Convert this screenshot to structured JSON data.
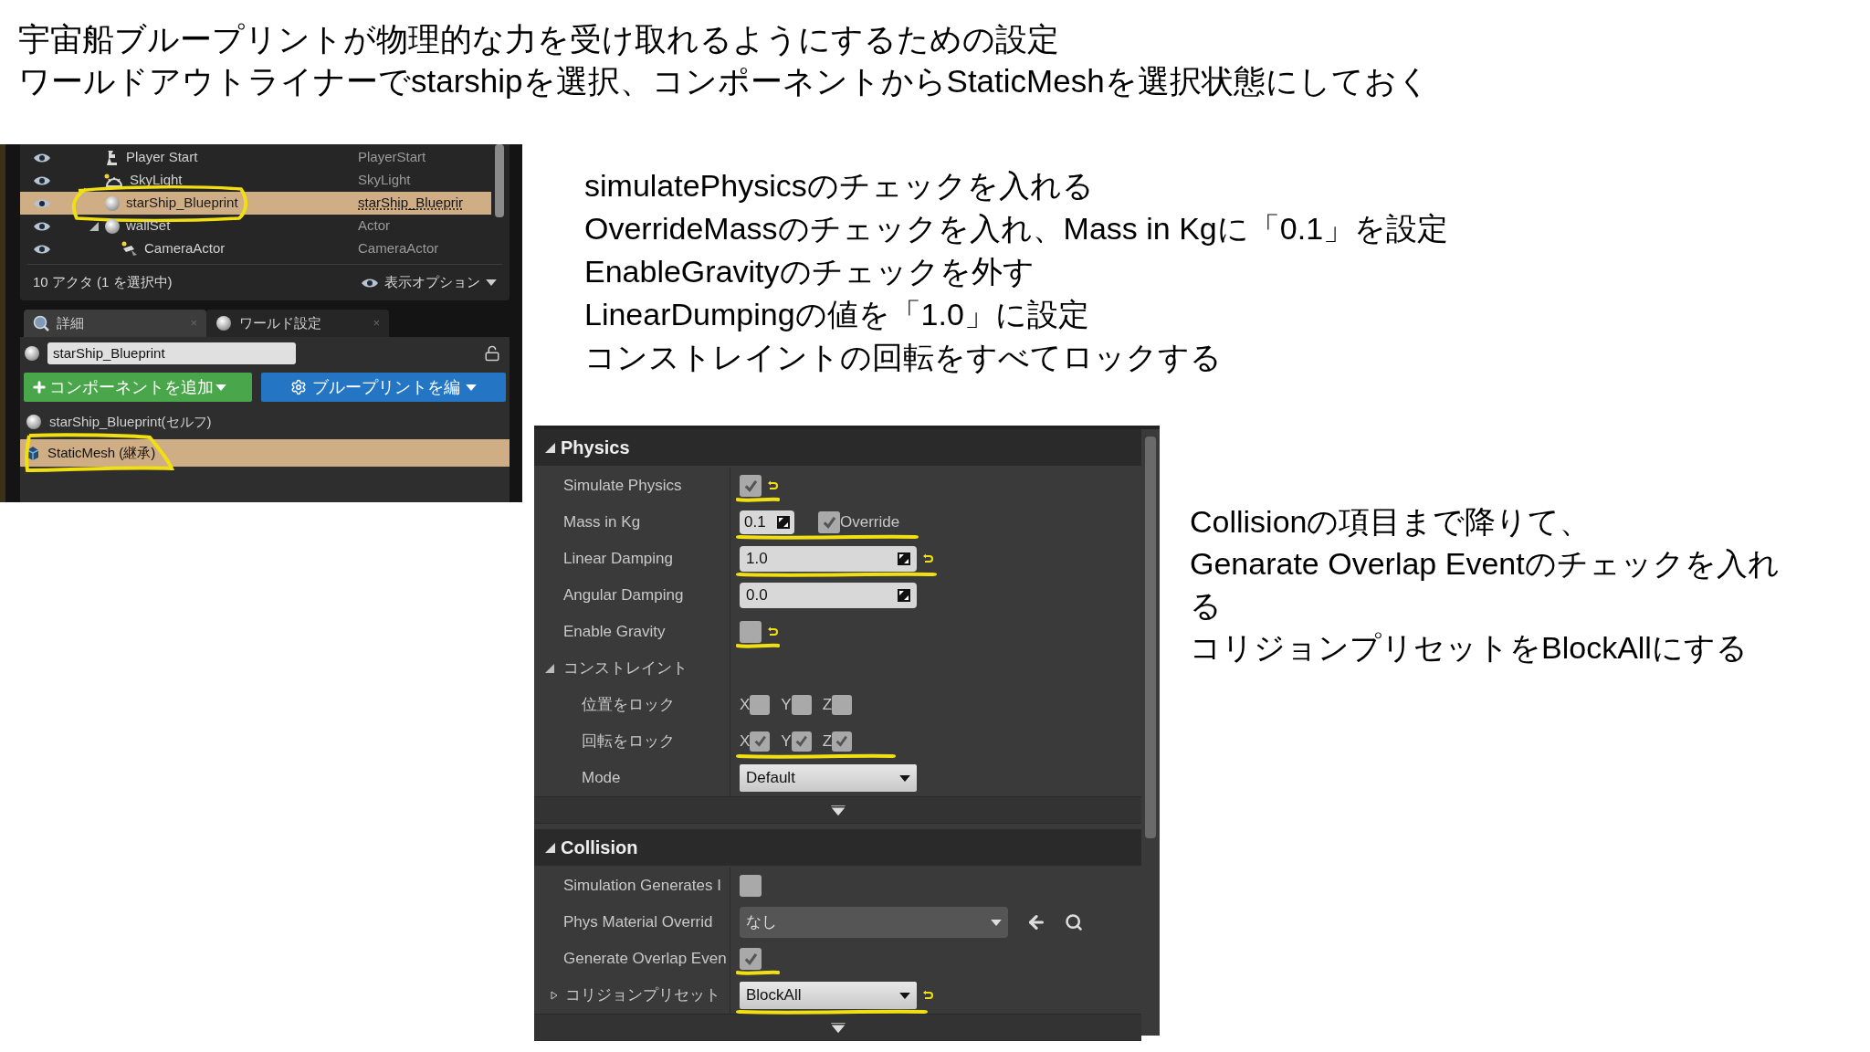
{
  "heading": [
    "宇宙船ブループリントが物理的な力を受け取れるようにするための設定",
    "ワールドアウトライナーでstarshipを選択、コンポーネントからStaticMeshを選択状態にしておく"
  ],
  "outliner": {
    "rows": [
      {
        "kind": "player",
        "name": "Player Start",
        "type": "PlayerStart",
        "selected": false,
        "marked": false
      },
      {
        "kind": "light",
        "name": "SkyLight",
        "type": "SkyLight",
        "selected": false,
        "marked": false
      },
      {
        "kind": "sphere",
        "name": "starShip_Blueprint",
        "type": "starShip_Blueprir",
        "selected": true,
        "marked": true
      },
      {
        "kind": "sphere",
        "name": "wallSet",
        "type": "Actor",
        "selected": false,
        "marked": false,
        "expanded": true,
        "children": [
          {
            "kind": "camera",
            "name": "CameraActor",
            "type": "CameraActor",
            "selected": false,
            "marked": false
          }
        ]
      }
    ],
    "footer": "10 アクタ (1 を選択中)",
    "view_options": "表示オプション"
  },
  "details": {
    "tabs": [
      {
        "label": "詳細",
        "selected": true,
        "close": "×"
      },
      {
        "label": "ワールド設定",
        "selected": false,
        "close": "×"
      }
    ],
    "name_field": "starShip_Blueprint",
    "add_button": "コンポーネントを追加",
    "blueprint_button": "ブループリントを編",
    "components": [
      {
        "name": "starShip_Blueprint(セルフ)",
        "selected": false,
        "marked": false
      },
      {
        "name": "StaticMesh (継承)",
        "selected": true,
        "marked": true
      }
    ]
  },
  "instructions": [
    "simulatePhysicsのチェックを入れる",
    "OverrideMassのチェックを入れ、Mass in Kgに「0.1」を設定",
    "EnableGravityのチェックを外す",
    "LinearDumpingの値を「1.0」に設定",
    "コンストレイントの回転をすべてロックする"
  ],
  "properties": {
    "sections": [
      {
        "title": "Physics",
        "expanded": true,
        "rows": [
          {
            "kind": "checkbox",
            "label": "Simulate Physics",
            "checked": true,
            "reset": true,
            "marked": true
          },
          {
            "kind": "mass",
            "label": "Mass in Kg",
            "value": "0.1",
            "override": {
              "label": "Override",
              "checked": true
            },
            "marked": true
          },
          {
            "kind": "number",
            "label": "Linear Damping",
            "value": "1.0",
            "reset": true,
            "marked": true
          },
          {
            "kind": "number",
            "label": "Angular Damping",
            "value": "0.0",
            "reset": false,
            "marked": false
          },
          {
            "kind": "checkbox",
            "label": "Enable Gravity",
            "checked": false,
            "reset": true,
            "marked": true
          },
          {
            "kind": "group",
            "label": "コンストレイント",
            "expanded": true
          },
          {
            "kind": "axes",
            "label": "位置をロック",
            "axes": [
              {
                "label": "X",
                "checked": false
              },
              {
                "label": "Y",
                "checked": false
              },
              {
                "label": "Z",
                "checked": false
              }
            ],
            "marked": false
          },
          {
            "kind": "axes",
            "label": "回転をロック",
            "axes": [
              {
                "label": "X",
                "checked": true
              },
              {
                "label": "Y",
                "checked": true
              },
              {
                "label": "Z",
                "checked": true
              }
            ],
            "marked": true
          },
          {
            "kind": "dropdown",
            "label": "Mode",
            "value": "Default",
            "reset": false,
            "marked": false
          }
        ]
      },
      {
        "title": "Collision",
        "expanded": true,
        "rows": [
          {
            "kind": "checkbox",
            "label": "Simulation Generates I",
            "checked": false,
            "reset": false,
            "marked": false
          },
          {
            "kind": "asset",
            "label": "Phys Material Overrid",
            "value": "なし"
          },
          {
            "kind": "checkbox",
            "label": "Generate Overlap Even",
            "checked": true,
            "reset": false,
            "marked": true
          },
          {
            "kind": "dropdown",
            "label": "コリジョンプリセット",
            "value": "BlockAll",
            "reset": true,
            "marked": true,
            "expanded": false
          }
        ]
      }
    ]
  },
  "note": [
    "Collisionの項目まで降りて、",
    "Genarate Overlap Eventのチェックを入れ",
    "る",
    "コリジョンプリセットをBlockAllにする"
  ]
}
